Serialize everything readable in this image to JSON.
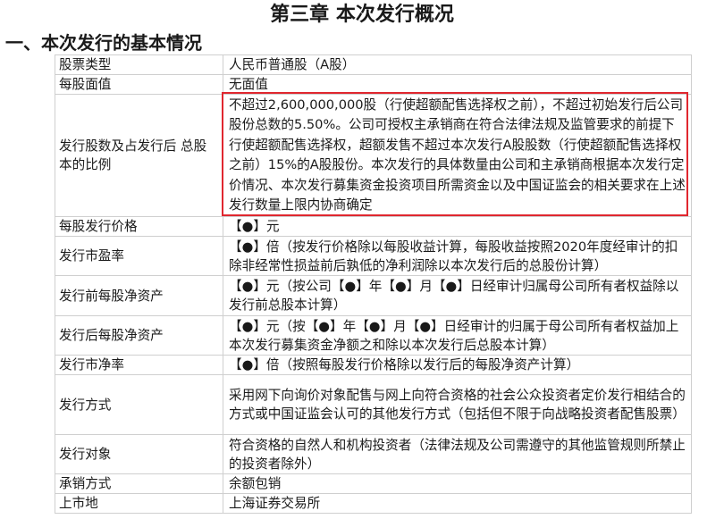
{
  "chapter_title": "第三章 本次发行概况",
  "section_title": "一、本次发行的基本情况",
  "rows": [
    {
      "label": "股票类型",
      "value": "人民币普通股（A股）"
    },
    {
      "label": "每股面值",
      "value": "无面值"
    },
    {
      "label": "发行股数及占发行后 总股本的比例",
      "value": "不超过2,600,000,000股（行使超额配售选择权之前），不超过初始发行后公司股份总数的5.50%。公司可授权主承销商在符合法律法规及监管要求的前提下行使超额配售选择权，超额发售不超过本次发行A股股数（行使超额配售选择权之前）15%的A股股份。本次发行的具体数量由公司和主承销商根据本次发行定价情况、本次发行募集资金投资项目所需资金以及中国证监会的相关要求在上述发行数量上限内协商确定"
    },
    {
      "label": "每股发行价格",
      "value": "【●】元"
    },
    {
      "label": "发行市盈率",
      "value": "【●】倍（按发行价格除以每股收益计算，每股收益按照2020年度经审计的扣除非经常性损益前后孰低的净利润除以本次发行后的总股份计算）"
    },
    {
      "label": "发行前每股净资产",
      "value": "【●】元（按公司【●】年【●】月【●】日经审计归属母公司所有者权益除以发行前总股本计算）"
    },
    {
      "label": "发行后每股净资产",
      "value": "【●】元（按【●】年【●】月【●】日经审计的归属于母公司所有者权益加上本次发行募集资金净额之和除以本次发行后总股本计算）"
    },
    {
      "label": "发行市净率",
      "value": "【●】倍（按照每股发行价格除以发行后的每股净资产计算）"
    },
    {
      "label": "发行方式",
      "value": "采用网下向询价对象配售与网上向符合资格的社会公众投资者定价发行相结合的方式或中国证监会认可的其他发行方式（包括但不限于向战略投资者配售股票）"
    },
    {
      "label": "发行对象",
      "value": "符合资格的自然人和机构投资者（法律法规及公司需遵守的其他监管规则所禁止的投资者除外）"
    },
    {
      "label": "承销方式",
      "value": "余额包销"
    },
    {
      "label": "上市地",
      "value": "上海证券交易所"
    }
  ],
  "colors": {
    "highlight_border": "#e0272f",
    "table_border": "#cfcfcf",
    "text": "#1a1a1a"
  }
}
